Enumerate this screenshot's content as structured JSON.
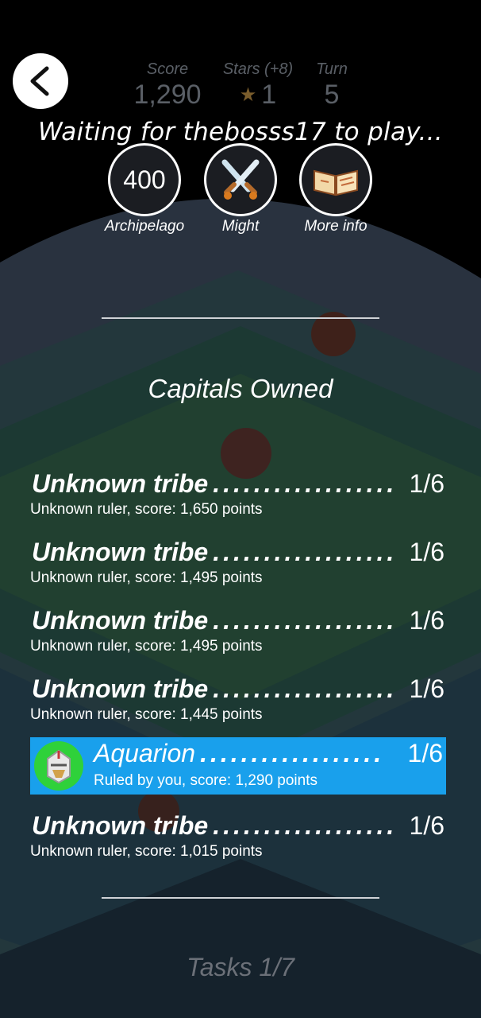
{
  "header": {
    "stats": [
      {
        "label": "Score",
        "value": "1,290"
      },
      {
        "label": "Stars (+8)",
        "value": "1",
        "icon": "star-icon"
      },
      {
        "label": "Turn",
        "value": "5"
      }
    ],
    "waiting_text": "Waiting for thebosss17 to play..."
  },
  "badges": [
    {
      "value": "400",
      "caption": "Archipelago"
    },
    {
      "icon": "crossed-swords-icon",
      "caption": "Might"
    },
    {
      "icon": "book-icon",
      "caption": "More info"
    }
  ],
  "section_title": "Capitals Owned",
  "tribes": [
    {
      "name": "Unknown tribe",
      "owned": "1/6",
      "detail": "Unknown ruler, score: 1,650 points"
    },
    {
      "name": "Unknown tribe",
      "owned": "1/6",
      "detail": "Unknown ruler, score: 1,495 points"
    },
    {
      "name": "Unknown tribe",
      "owned": "1/6",
      "detail": "Unknown ruler, score: 1,495 points"
    },
    {
      "name": "Unknown tribe",
      "owned": "1/6",
      "detail": "Unknown ruler, score: 1,445 points"
    },
    {
      "name": "Aquarion",
      "owned": "1/6",
      "detail": "Ruled by you, score: 1,290 points",
      "highlight": true
    },
    {
      "name": "Unknown tribe",
      "owned": "1/6",
      "detail": "Unknown ruler, score: 1,015 points"
    }
  ],
  "dots": "..................",
  "tasks_label": "Tasks 1/7",
  "colors": {
    "highlight": "#19a0ec",
    "avatar_bg": "#2fd13a"
  }
}
